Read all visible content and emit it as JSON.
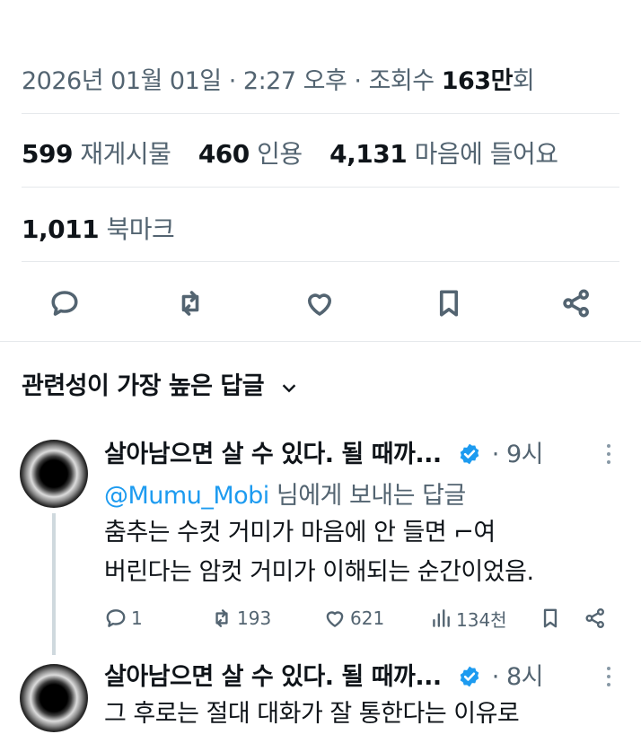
{
  "tweet": {
    "date": "2026년 01월 01일",
    "separator": "·",
    "time": "2:27 오후",
    "views_label": "조회수",
    "views_value": "163만",
    "views_suffix": "회"
  },
  "stats": {
    "retweets": {
      "num": "599",
      "label": "재게시물"
    },
    "quotes": {
      "num": "460",
      "label": "인용"
    },
    "likes": {
      "num": "4,131",
      "label": "마음에 들어요"
    },
    "bookmarks": {
      "num": "1,011",
      "label": "북마크"
    }
  },
  "actions": [
    "reply-icon",
    "retweet-icon",
    "like-icon",
    "bookmark-icon",
    "share-icon"
  ],
  "replies_header": {
    "label": "관련성이 가장 높은 답글",
    "icon": "chevron-down-icon"
  },
  "replies": [
    {
      "name": "살아남으면 살 수 있다. 될 때까...",
      "time": "· 9시",
      "reply_to_handle": "@Mumu_Mobi",
      "reply_to_suffix": " 님에게 보내는 답글",
      "lines": [
        "춤추는 수컷 거미가 마음에 안 들면 ⌐여",
        "버린다는 암컷 거미가 이해되는 순간이었음."
      ],
      "replies": "1",
      "retweets": "193",
      "likes": "621",
      "views": "134천"
    },
    {
      "name": "살아남으면 살 수 있다. 될 때까...",
      "time": "· 8시",
      "lines": [
        "그 후로는 절대 대화가 잘 통한다는 이유로"
      ]
    }
  ],
  "colors": {
    "text": "#0f1419",
    "secondary": "#536471",
    "link": "#1d9bf0",
    "verified": "#1d9bf0",
    "divider": "#e6e9ec"
  }
}
